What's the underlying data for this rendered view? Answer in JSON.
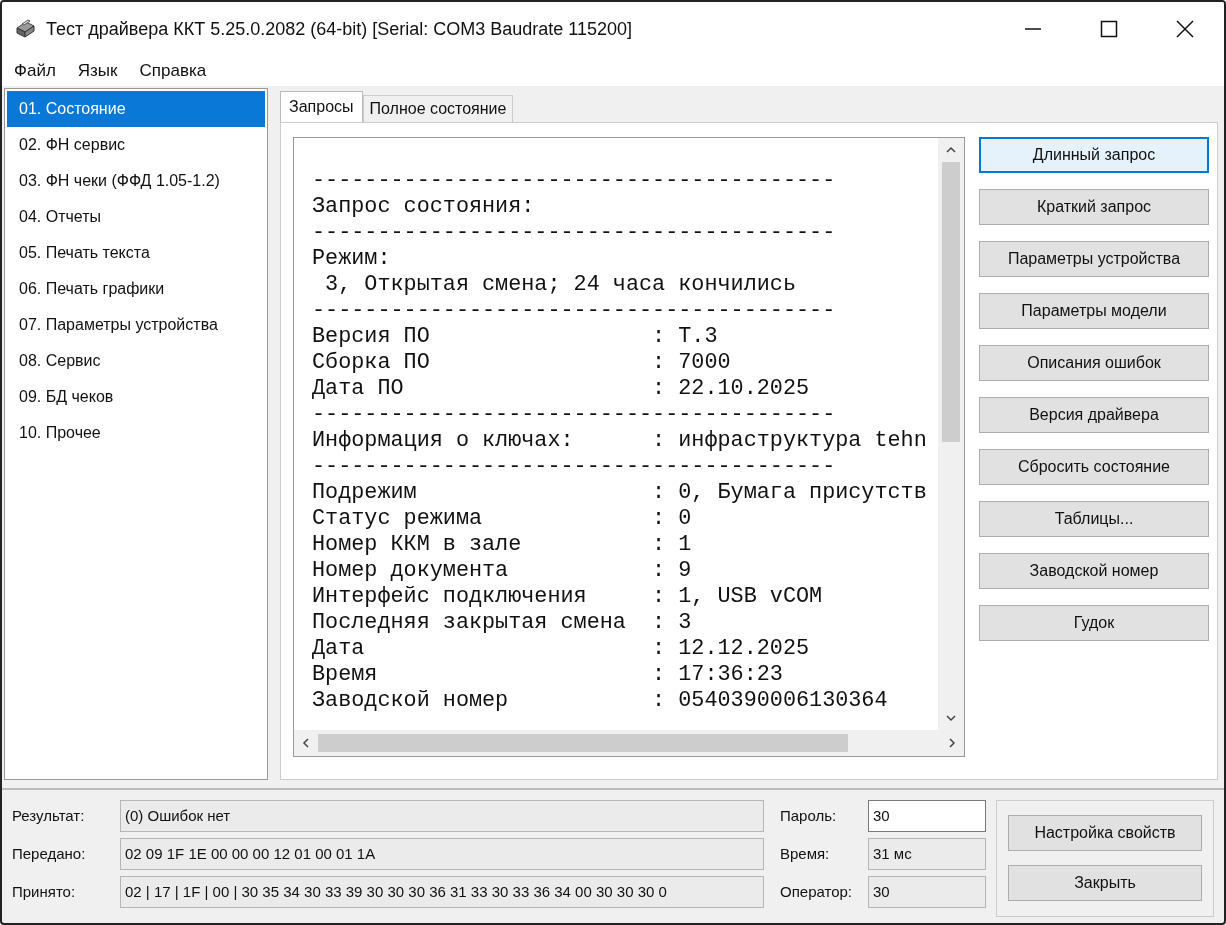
{
  "window": {
    "title": "Тест драйвера ККТ 5.25.0.2082 (64-bit) [Serial: COM3 Baudrate 115200]"
  },
  "menu": [
    "Файл",
    "Язык",
    "Справка"
  ],
  "sidebar": {
    "items": [
      {
        "label": "01. Состояние",
        "selected": true
      },
      {
        "label": "02. ФН сервис",
        "selected": false
      },
      {
        "label": "03. ФН чеки (ФФД 1.05-1.2)",
        "selected": false
      },
      {
        "label": "04. Отчеты",
        "selected": false
      },
      {
        "label": "05. Печать текста",
        "selected": false
      },
      {
        "label": "06. Печать графики",
        "selected": false
      },
      {
        "label": "07. Параметры устройства",
        "selected": false
      },
      {
        "label": "08. Сервис",
        "selected": false
      },
      {
        "label": "09. БД чеков",
        "selected": false
      },
      {
        "label": "10. Прочее",
        "selected": false
      }
    ]
  },
  "tabs": [
    {
      "label": "Запросы",
      "selected": true
    },
    {
      "label": "Полное состояние",
      "selected": false
    }
  ],
  "output": {
    "lines": [
      "----------------------------------------",
      "Запрос состояния:",
      "----------------------------------------",
      "Режим:",
      " 3, Открытая смена; 24 часа кончились",
      "----------------------------------------",
      "Версия ПО                 : T.3",
      "Сборка ПО                 : 7000",
      "Дата ПО                   : 22.10.2025",
      "----------------------------------------",
      "Информация о ключах:      : инфраструктура tehn",
      "----------------------------------------",
      "Подрежим                  : 0, Бумага присутств",
      "Статус режима             : 0",
      "Номер ККМ в зале          : 1",
      "Номер документа           : 9",
      "Интерфейс подключения     : 1, USB vCOM",
      "Последняя закрытая смена  : 3",
      "Дата                      : 12.12.2025",
      "Время                     : 17:36:23",
      "Заводской номер           : 0540390006130364"
    ]
  },
  "actions": [
    {
      "label": "Длинный запрос",
      "focused": true
    },
    {
      "label": "Краткий запрос",
      "focused": false
    },
    {
      "label": "Параметры устройства",
      "focused": false
    },
    {
      "label": "Параметры модели",
      "focused": false
    },
    {
      "label": "Описания ошибок",
      "focused": false
    },
    {
      "label": "Версия драйвера",
      "focused": false
    },
    {
      "label": "Сбросить состояние",
      "focused": false
    },
    {
      "label": "Таблицы...",
      "focused": false
    },
    {
      "label": "Заводской номер",
      "focused": false
    },
    {
      "label": "Гудок",
      "focused": false
    }
  ],
  "status": {
    "fields": [
      {
        "label": "Результат:",
        "value": "(0) Ошибок нет"
      },
      {
        "label": "Передано:",
        "value": "02 09 1F 1E 00 00 00 12 01 00 01 1A"
      },
      {
        "label": "Принято:",
        "value": "02 | 17 | 1F | 00 | 30 35 34 30 33 39 30 30 30 36 31 33 30 33 36 34 00 30 30 30 0"
      }
    ],
    "side_fields": [
      {
        "label": "Пароль:",
        "value": "30",
        "editable": true
      },
      {
        "label": "Время:",
        "value": "31 мс",
        "editable": false
      },
      {
        "label": "Оператор:",
        "value": "30",
        "editable": false
      }
    ],
    "buttons": [
      "Настройка свойств",
      "Закрыть"
    ]
  }
}
